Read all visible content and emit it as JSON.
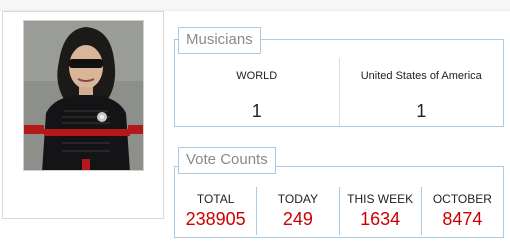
{
  "musicians": {
    "title": "Musicians",
    "columns": [
      {
        "label": "WORLD",
        "value": "1"
      },
      {
        "label": "United States of America",
        "value": "1"
      }
    ]
  },
  "votes": {
    "title": "Vote Counts",
    "value_color": "#cc0000",
    "columns": [
      {
        "label": "TOTAL",
        "value": "238905"
      },
      {
        "label": "TODAY",
        "value": "249"
      },
      {
        "label": "THIS WEEK",
        "value": "1634"
      },
      {
        "label": "OCTOBER",
        "value": "8474"
      }
    ]
  },
  "theme": {
    "panel_border": "#a9c9e4",
    "legend_text": "#8a8a8a"
  }
}
